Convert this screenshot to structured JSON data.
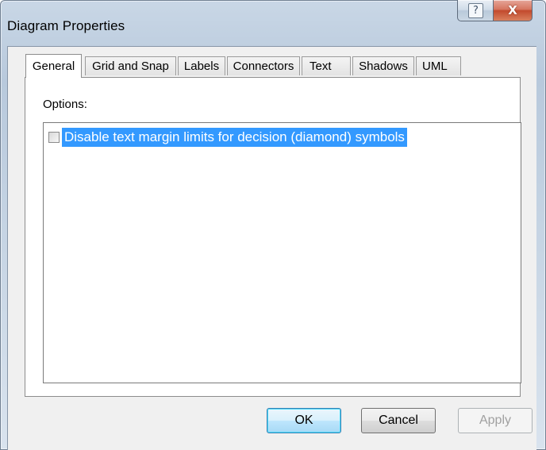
{
  "window": {
    "title": "Diagram Properties",
    "help_glyph": "?",
    "close_glyph": "X"
  },
  "tabs": [
    {
      "label": "General",
      "active": true
    },
    {
      "label": "Grid and Snap",
      "active": false
    },
    {
      "label": "Labels",
      "active": false
    },
    {
      "label": "Connectors",
      "active": false
    },
    {
      "label": "Text",
      "active": false
    },
    {
      "label": "Shadows",
      "active": false
    },
    {
      "label": "UML",
      "active": false
    }
  ],
  "general": {
    "options_label": "Options:",
    "options": [
      {
        "label": "Disable text margin limits for decision (diamond) symbols",
        "checked": false,
        "selected": true
      }
    ]
  },
  "buttons": {
    "ok": "OK",
    "cancel": "Cancel",
    "apply": "Apply"
  },
  "colors": {
    "selection": "#3399ff",
    "close_button": "#c24a2d"
  }
}
